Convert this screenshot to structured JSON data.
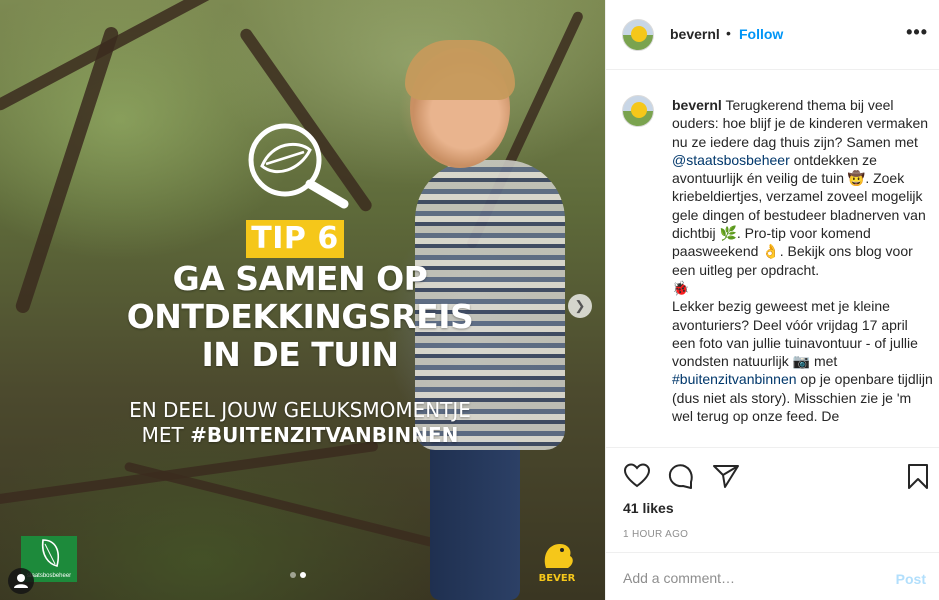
{
  "media": {
    "tip_badge": "TIP 6",
    "headline_lines": [
      "GA SAMEN OP",
      "ONTDEKKINGSREIS",
      "IN DE TUIN"
    ],
    "sub_line1": "EN DEEL JOUW GELUKSMOMENTJE",
    "sub_line2_prefix": "MET ",
    "sub_line2_tag": "#BUITENZITVANBINNEN",
    "logo_left_text": "staatsbosbeheer",
    "logo_right_text": "BEVER",
    "carousel_slide": 2,
    "carousel_total": 2,
    "colors": {
      "badge": "#f5c71a",
      "logo_left": "#1d8a3b"
    }
  },
  "header": {
    "username": "bevernl",
    "separator": "•",
    "follow_label": "Follow",
    "more_label": "•••"
  },
  "caption": {
    "username": "bevernl",
    "part1": " Terugkerend thema bij veel ouders: hoe blijf je de kinderen vermaken nu ze iedere dag thuis zijn? Samen met ",
    "mention": "@staatsbosbeheer",
    "part2": " ontdekken ze avontuurlijk én veilig de tuin 🤠. Zoek kriebeldiertjes, verzamel zoveel mogelijk gele dingen of bestudeer bladnerven van dichtbij 🌿. Pro-tip voor komend paasweekend 👌. Bekijk ons blog voor een uitleg per opdracht.\n🐞\nLekker bezig geweest met je kleine avonturiers? Deel vóór vrijdag 17 april een foto van jullie tuinavontuur - of jullie vondsten natuurlijk 📷 met ",
    "hashtag": "#buitenzitvanbinnen",
    "part3": " op je openbare tijdlijn (dus niet als story). Misschien zie je 'm wel terug op onze feed. De"
  },
  "actions": {
    "like_icon": "heart-icon",
    "comment_icon": "comment-icon",
    "share_icon": "paper-plane-icon",
    "save_icon": "bookmark-icon"
  },
  "stats": {
    "likes": "41 likes",
    "time": "1 HOUR AGO"
  },
  "comment_box": {
    "placeholder": "Add a comment…",
    "post_label": "Post",
    "colors": {
      "post_disabled": "#b2dffc",
      "link": "#0095f6"
    }
  }
}
